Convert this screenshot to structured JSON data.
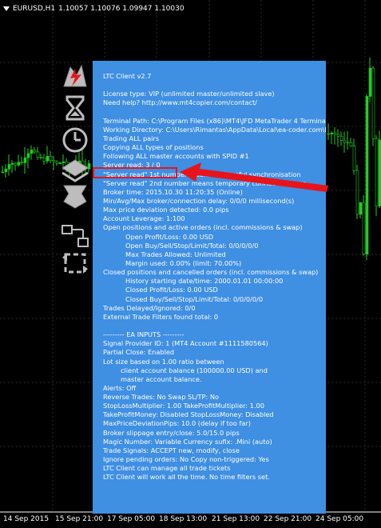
{
  "window": {
    "symbol": "EURUSD,H1",
    "ohlc": "1.10057 1.10076 1.09947 1.10030"
  },
  "x_axis_labels": [
    "14 Sep 2015",
    "15 Sep 21:00",
    "17 Sep 05:00",
    "18 Sep 13:00",
    "21 Sep 13:00",
    "22 Sep 21:00",
    "24 Sep 05:00",
    "25 Sep 13:00"
  ],
  "icons": [
    "lightning-logo-icon",
    "hourglass-icon",
    "clock-icon",
    "grid-filter-icon",
    "money-icon",
    "network-icon",
    "refresh-icon"
  ],
  "colors": {
    "panel": "#3f8fe3",
    "highlight": "#e8141b",
    "candles": "#22cc22"
  },
  "panel": {
    "lines": [
      {
        "text": "LTC Client v2.7",
        "indent": 0
      },
      {
        "text": "",
        "indent": 0
      },
      {
        "text": "License type: VIP (unlimited master/unlimited slave)",
        "indent": 0
      },
      {
        "text": "Need help? http://www.mt4copier.com/contact/",
        "indent": 0
      },
      {
        "text": "",
        "indent": 0
      },
      {
        "text": "Terminal Path: C:\\Program Files (x86)\\MT4\\JFD MetaTrader 4 Terminal-2",
        "indent": 0
      },
      {
        "text": "Working Directory: C:\\Users\\Rimantas\\AppData\\Local\\ea-coder.com\\LTC\\ltctrades\\",
        "indent": 0
      },
      {
        "text": "Trading ALL pairs",
        "indent": 0
      },
      {
        "text": "Copying ALL types of positions",
        "indent": 0
      },
      {
        "text": "Following ALL master accounts with SPID #1",
        "indent": 0
      },
      {
        "text": "Server read: 3 / 0",
        "indent": 0
      },
      {
        "text": "\"Server read\" 1st number means successful synchronisation",
        "indent": 0
      },
      {
        "text": "\"Server read\" 2nd number means temporary connection error",
        "indent": 0
      },
      {
        "text": "Broker time: 2015.10.30 11:20:35 (Online)",
        "indent": 0
      },
      {
        "text": "Min/Avg/Max broker/connection delay: 0/0/0 millisecond(s)",
        "indent": 0
      },
      {
        "text": "Max price deviation detected: 0.0 pips",
        "indent": 0
      },
      {
        "text": "Account Leverage: 1:100",
        "indent": 0
      },
      {
        "text": "Open positions and active orders (incl. commissions & swap)",
        "indent": 0
      },
      {
        "text": "Open Profit/Loss: 0.00 USD",
        "indent": 2
      },
      {
        "text": "Open Buy/Sell/Stop/Limit/Total: 0/0/0/0/0",
        "indent": 2
      },
      {
        "text": "Max Trades Allowed: Unlimited",
        "indent": 2
      },
      {
        "text": "Margin used: 0.00% (limit: 70.00%)",
        "indent": 2
      },
      {
        "text": "Closed positions and cancelled orders (incl. commissions & swap)",
        "indent": 0
      },
      {
        "text": "History starting date/time: 2000.01.01 00:00:00",
        "indent": 2
      },
      {
        "text": "Closed Profit/Loss: 0.00 USD",
        "indent": 2
      },
      {
        "text": "Closed Buy/Sell/Stop/Limit/Total: 0/0/0/0/0",
        "indent": 2
      },
      {
        "text": "Trades Delayed/Ignored: 0/0",
        "indent": 0
      },
      {
        "text": "External Trade Filters found total: 0",
        "indent": 0
      },
      {
        "text": "",
        "indent": 0
      },
      {
        "text": "--------- EA INPUTS ---------",
        "indent": 0
      },
      {
        "text": "Signal Provider ID: 1 (MT4 Account #1111580564)",
        "indent": 0
      },
      {
        "text": "Partial Close: Enabled",
        "indent": 0
      },
      {
        "text": "Lot size based on 1.00 ratio between",
        "indent": 0
      },
      {
        "text": "client account balance (100000.00 USD) and",
        "indent": 1
      },
      {
        "text": "master account balance.",
        "indent": 1
      },
      {
        "text": "Alerts: Off",
        "indent": 0
      },
      {
        "text": "Reverse Trades: No     Swap SL/TP: No",
        "indent": 0
      },
      {
        "text": "StopLossMultiplier: 1.00     TakeProfitMultiplier: 1.00",
        "indent": 0
      },
      {
        "text": "TakeProfitMoney: Disabled     StopLossMoney: Disabled",
        "indent": 0
      },
      {
        "text": "MaxPriceDeviationPips: 10.0 (delay if too far)",
        "indent": 0
      },
      {
        "text": "Broker slippage entry/close: 5.0/15.0 pips",
        "indent": 0
      },
      {
        "text": "Magic Number: Variable     Currency sufix: .Mini (auto)",
        "indent": 0
      },
      {
        "text": "Trade Signals: ACCEPT new, modify, close",
        "indent": 0
      },
      {
        "text": "Ignore pending orders: No     Copy non-triggered: Yes",
        "indent": 0
      },
      {
        "text": "LTC Client can manage all trade tickets",
        "indent": 0
      },
      {
        "text": "LTC Client will work all the time. No time filters set.",
        "indent": 0
      }
    ]
  }
}
